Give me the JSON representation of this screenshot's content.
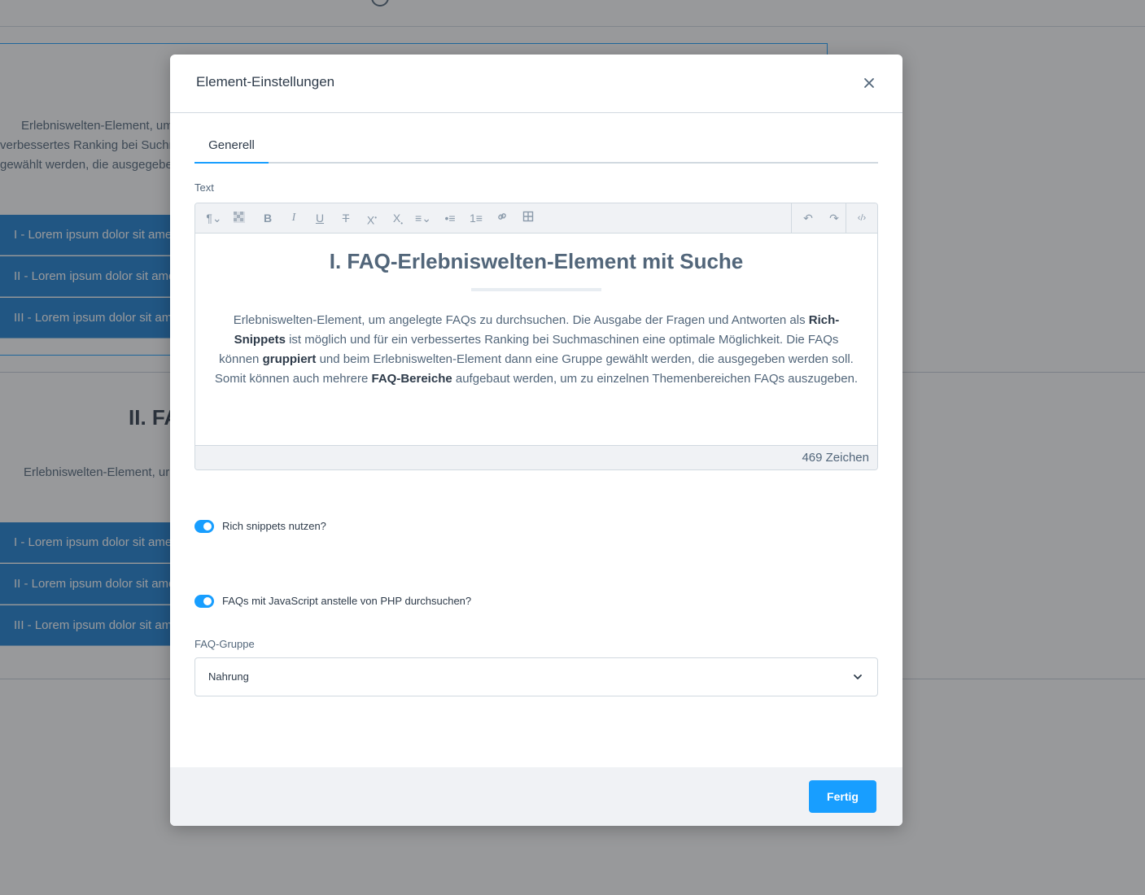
{
  "background": {
    "block1_lines": [
      "Erlebniswelten-Element, um",
      "verbessertes Ranking bei Suchm",
      "gewählt werden, die ausgegebe"
    ],
    "accordion1": [
      "I - Lorem ipsum dolor sit ame",
      "II - Lorem ipsum dolor sit ame",
      "III - Lorem ipsum dolor sit am"
    ],
    "heading2": "II. FA",
    "block2_line": "Erlebniswelten-Element, ur",
    "accordion2": [
      "I - Lorem ipsum dolor sit ame",
      "II - Lorem ipsum dolor sit ame",
      "III - Lorem ipsum dolor sit am"
    ]
  },
  "modal": {
    "title": "Element-Einstellungen",
    "close_icon": "close-icon",
    "tabs": [
      {
        "label": "Generell",
        "active": true
      }
    ],
    "text_label": "Text",
    "editor": {
      "toolbar": [
        "paragraph-format-icon",
        "clear-format-icon",
        "bold-icon",
        "italic-icon",
        "underline-icon",
        "strikethrough-icon",
        "superscript-icon",
        "subscript-icon",
        "align-icon",
        "unordered-list-icon",
        "ordered-list-icon",
        "link-icon",
        "table-icon",
        "undo-icon",
        "redo-icon",
        "code-view-icon"
      ],
      "heading": "I. FAQ-Erlebniswelten-Element mit Suche",
      "paragraph": {
        "p1": "Erlebniswelten-Element, um angelegte FAQs zu durchsuchen. Die Ausgabe der Fragen und Antworten als ",
        "b1": "Rich-Snippets",
        "p2": " ist möglich und für ein verbessertes Ranking bei Suchmaschinen eine optimale Möglichkeit. Die FAQs können ",
        "b2": "gruppiert",
        "p3": " und beim Erlebniswelten-Element dann eine Gruppe gewählt werden, die ausgegeben werden soll. Somit können auch mehrere ",
        "b3": "FAQ-Bereiche",
        "p4": " aufgebaut werden, um zu einzelnen Themenbereichen FAQs auszugeben."
      },
      "char_count": "469 Zeichen"
    },
    "switches": [
      {
        "label": "Rich snippets nutzen?",
        "checked": true
      },
      {
        "label": "FAQs mit JavaScript anstelle von PHP durchsuchen?",
        "checked": true
      }
    ],
    "faq_group_label": "FAQ-Gruppe",
    "faq_group_value": "Nahrung",
    "done_button": "Fertig"
  },
  "colors": {
    "accent": "#189eff",
    "accordion": "#1c7fd1",
    "overlay": "rgba(40,42,46,0.48)"
  }
}
